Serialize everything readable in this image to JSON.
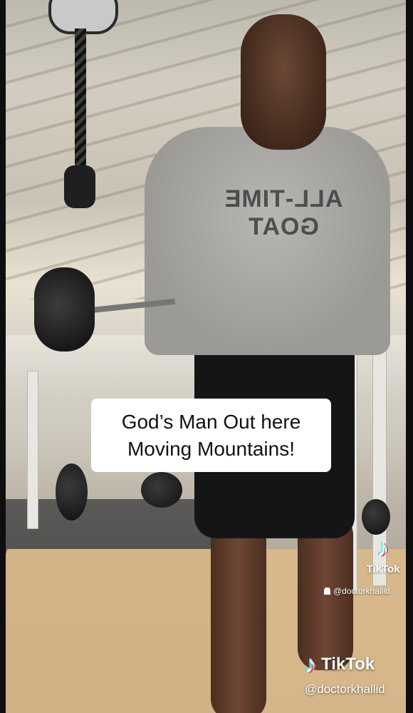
{
  "caption": {
    "line1": "God’s Man Out here",
    "line2": "Moving Mountains!"
  },
  "shirt_print": "ALL-TIME GOAT",
  "watermark_small": {
    "logo_icon": "tiktok-logo-icon",
    "brand": "TikTok",
    "user_icon": "user-icon",
    "username": "@doctorkhallid"
  },
  "watermark_large": {
    "logo_icon": "tiktok-logo-icon",
    "brand": "TikTok",
    "username": "@doctorkhallid"
  },
  "colors": {
    "caption_bg": "#ffffff",
    "caption_text": "#111111",
    "tiktok_cyan": "#25f4ee",
    "tiktok_red": "#fe2c55"
  }
}
